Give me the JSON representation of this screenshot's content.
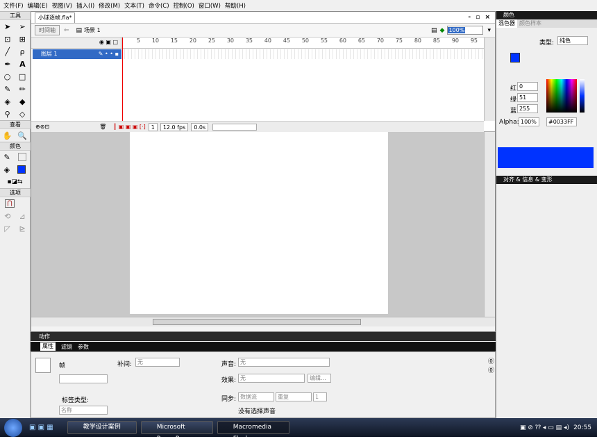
{
  "menu": [
    "文件(F)",
    "编辑(E)",
    "视图(V)",
    "插入(I)",
    "修改(M)",
    "文本(T)",
    "命令(C)",
    "控制(O)",
    "窗口(W)",
    "帮助(H)"
  ],
  "tools": {
    "title": "工具",
    "view": "查看",
    "colors": "颜色",
    "options": "选项"
  },
  "doc": {
    "tab": "小球逐帧.fla*",
    "timeline_btn": "时间轴",
    "scene": "场景 1",
    "zoom": "100%",
    "layer": "图层 1",
    "ruler": [
      "5",
      "10",
      "15",
      "20",
      "25",
      "30",
      "35",
      "40",
      "45",
      "50",
      "55",
      "60",
      "65",
      "70",
      "75",
      "80",
      "85",
      "90",
      "95"
    ],
    "frame": "1",
    "fps": "12.0 fps",
    "time": "0.0s"
  },
  "actions": "动作",
  "props": {
    "tabs": [
      "属性",
      "滤镜",
      "参数"
    ],
    "frame": "帧",
    "tween_label": "补间:",
    "tween": "无",
    "sound_label": "声音:",
    "sound": "无",
    "effect_label": "效果:",
    "effect": "无",
    "edit": "编辑...",
    "sync_label": "同步:",
    "sync": "数据流",
    "repeat": "重复",
    "count": "1",
    "no_sound": "没有选择声音",
    "label_type": "标签类型:",
    "name_ph": "名称"
  },
  "color": {
    "title": "颜色",
    "mixer": "混色器",
    "swatches": "颜色样本",
    "type_label": "类型:",
    "type": "纯色",
    "r_label": "红:",
    "r": "0",
    "g_label": "绿:",
    "g": "51",
    "b_label": "蓝:",
    "b": "255",
    "alpha_label": "Alpha:",
    "alpha": "100%",
    "hex": "#0033FF",
    "fill": "#0033ff"
  },
  "align_panel": "对齐 & 信息 & 变形",
  "taskbar": {
    "items": [
      "教学设计案例",
      "Microsoft PowerP...",
      "Macromedia Flash..."
    ],
    "time": "20:55"
  }
}
